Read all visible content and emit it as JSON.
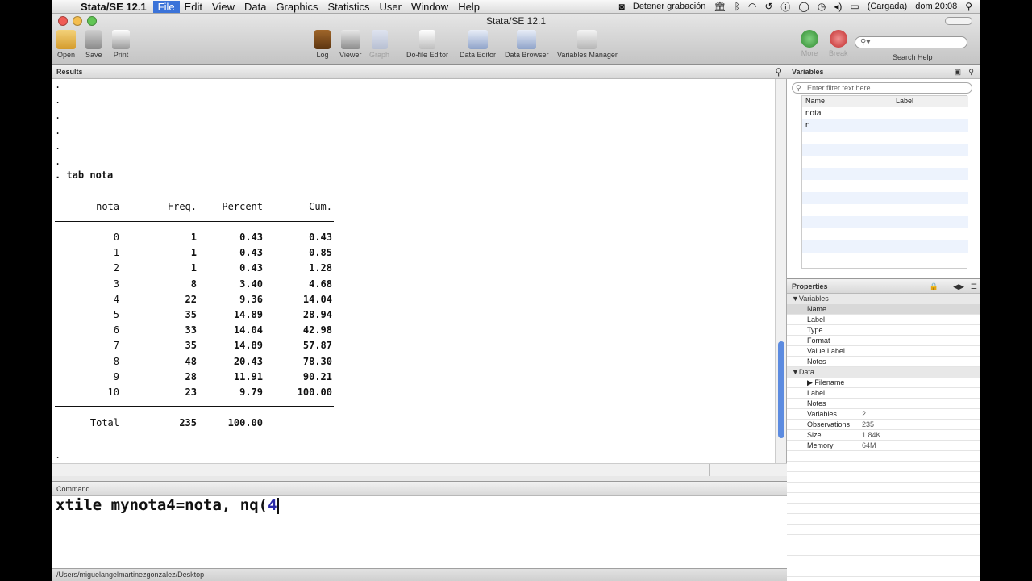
{
  "menubar": {
    "app": "Stata/SE 12.1",
    "items": [
      "File",
      "Edit",
      "View",
      "Data",
      "Graphics",
      "Statistics",
      "User",
      "Window",
      "Help"
    ],
    "recording": "Detener grabación",
    "battery": "(Cargada)",
    "clock": "dom 20:08"
  },
  "window": {
    "title": "Stata/SE 12.1"
  },
  "toolbar": {
    "open": "Open",
    "save": "Save",
    "print": "Print",
    "log": "Log",
    "viewer": "Viewer",
    "graph": "Graph",
    "dofile": "Do-file Editor",
    "data_editor": "Data Editor",
    "data_browser": "Data Browser",
    "var_manager": "Variables Manager",
    "more": "More",
    "break": "Break",
    "search_help": "Search Help"
  },
  "results": {
    "title": "Results",
    "command": ". tab nota",
    "headers": [
      "nota",
      "Freq.",
      "Percent",
      "Cum."
    ],
    "rows": [
      [
        "0",
        "1",
        "0.43",
        "0.43"
      ],
      [
        "1",
        "1",
        "0.43",
        "0.85"
      ],
      [
        "2",
        "1",
        "0.43",
        "1.28"
      ],
      [
        "3",
        "8",
        "3.40",
        "4.68"
      ],
      [
        "4",
        "22",
        "9.36",
        "14.04"
      ],
      [
        "5",
        "35",
        "14.89",
        "28.94"
      ],
      [
        "6",
        "33",
        "14.04",
        "42.98"
      ],
      [
        "7",
        "35",
        "14.89",
        "57.87"
      ],
      [
        "8",
        "48",
        "20.43",
        "78.30"
      ],
      [
        "9",
        "28",
        "11.91",
        "90.21"
      ],
      [
        "10",
        "23",
        "9.79",
        "100.00"
      ]
    ],
    "total": [
      "Total",
      "235",
      "100.00",
      ""
    ]
  },
  "command": {
    "title": "Command",
    "text": "xtile mynota4=nota, nq(",
    "tail": "4"
  },
  "status": {
    "path": "/Users/miguelangelmartinezgonzalez/Desktop"
  },
  "variables": {
    "title": "Variables",
    "filter_placeholder": "Enter filter text here",
    "col_name": "Name",
    "col_label": "Label",
    "items": [
      "nota",
      "n"
    ]
  },
  "properties": {
    "title": "Properties",
    "sec_vars": "▼Variables",
    "var_fields": [
      "Name",
      "Label",
      "Type",
      "Format",
      "Value Label",
      "Notes"
    ],
    "sec_data": "▼Data",
    "data_fields": [
      [
        "▶ Filename",
        ""
      ],
      [
        "Label",
        ""
      ],
      [
        "Notes",
        ""
      ],
      [
        "Variables",
        "2"
      ],
      [
        "Observations",
        "235"
      ],
      [
        "Size",
        "1.84K"
      ],
      [
        "Memory",
        "64M"
      ]
    ]
  }
}
